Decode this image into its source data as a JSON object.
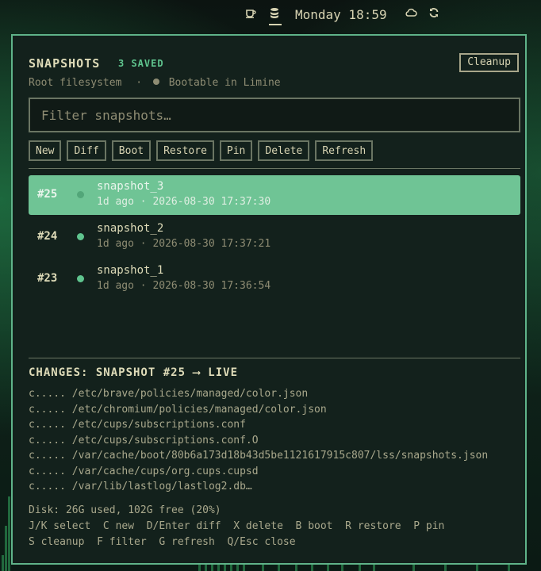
{
  "topbar": {
    "clock": "Monday 18:59",
    "icons": [
      "coffee-icon",
      "database-icon",
      "cloud-icon",
      "refresh-icon"
    ]
  },
  "window": {
    "title": "SNAPSHOTS",
    "count": "3 SAVED",
    "cleanup_label": "Cleanup",
    "subtitle_fs": "Root filesystem",
    "subtitle_sep": "·",
    "subtitle_boot": "Bootable in Limine",
    "filter_placeholder": "Filter snapshots…",
    "toolbar": [
      "New",
      "Diff",
      "Boot",
      "Restore",
      "Pin",
      "Delete",
      "Refresh"
    ]
  },
  "snapshots": [
    {
      "num": "#25",
      "name": "snapshot_3",
      "meta": "1d ago · 2026-08-30 17:37:30",
      "selected": true
    },
    {
      "num": "#24",
      "name": "snapshot_2",
      "meta": "1d ago · 2026-08-30 17:37:21",
      "selected": false
    },
    {
      "num": "#23",
      "name": "snapshot_1",
      "meta": "1d ago · 2026-08-30 17:36:54",
      "selected": false
    }
  ],
  "changes": {
    "title": "CHANGES: SNAPSHOT #25 ⟶ LIVE",
    "lines": [
      "c..... /etc/brave/policies/managed/color.json",
      "c..... /etc/chromium/policies/managed/color.json",
      "c..... /etc/cups/subscriptions.conf",
      "c..... /etc/cups/subscriptions.conf.O",
      "c..... /var/cache/boot/80b6a173d18b43d5be1121617915c807/lss/snapshots.json",
      "c..... /var/cache/cups/org.cups.cupsd",
      "c..... /var/lib/lastlog/lastlog2.db…"
    ]
  },
  "footer": {
    "disk": "Disk: 26G used, 102G free (20%)",
    "keys1": "J/K select  C new  D/Enter diff  X delete  B boot  R restore  P pin",
    "keys2": "S cleanup  F filter  G refresh  Q/Esc close"
  },
  "colors": {
    "accent": "#5fb389",
    "selected": "#6fc495",
    "panel": "#13211c"
  }
}
